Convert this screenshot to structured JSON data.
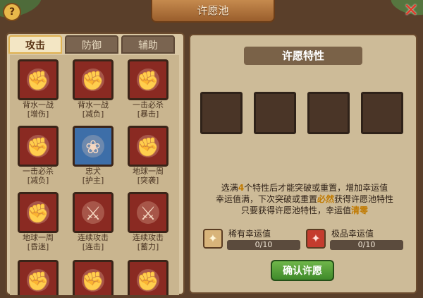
{
  "header": {
    "title": "许愿池"
  },
  "tabs": [
    {
      "label": "攻击",
      "active": true
    },
    {
      "label": "防御",
      "active": false
    },
    {
      "label": "辅助",
      "active": false
    }
  ],
  "skills": [
    {
      "name": "背水一战",
      "tag": "[增伤]",
      "icon": "berserker-portrait-icon",
      "color": "#8a2a22"
    },
    {
      "name": "背水一战",
      "tag": "[减负]",
      "icon": "berserker-portrait-icon",
      "color": "#8a2a22"
    },
    {
      "name": "一击必杀",
      "tag": "[暴击]",
      "icon": "punch-strike-icon",
      "color": "#8a2a22"
    },
    {
      "name": "一击必杀",
      "tag": "[减负]",
      "icon": "punch-strike-icon",
      "color": "#8a2a22"
    },
    {
      "name": "忠犬",
      "tag": "[护主]",
      "icon": "paw-print-icon",
      "color": "#3d6ea8"
    },
    {
      "name": "地球一周",
      "tag": "[突袭]",
      "icon": "globe-fist-icon",
      "color": "#8a2a22"
    },
    {
      "name": "地球一周",
      "tag": "[昏迷]",
      "icon": "globe-fist-icon",
      "color": "#8a2a22"
    },
    {
      "name": "连续攻击",
      "tag": "[连击]",
      "icon": "slash-combo-icon",
      "color": "#8a2a22"
    },
    {
      "name": "连续攻击",
      "tag": "[蓄力]",
      "icon": "slash-combo-icon",
      "color": "#8a2a22"
    },
    {
      "name": "",
      "tag": "",
      "icon": "berserker-portrait-icon",
      "color": "#8a2a22"
    },
    {
      "name": "",
      "tag": "",
      "icon": "berserker-portrait-icon",
      "color": "#8a2a22"
    },
    {
      "name": "",
      "tag": "",
      "icon": "paw-strike-icon",
      "color": "#8a2a22"
    }
  ],
  "wish": {
    "title": "许愿特性",
    "line1_pre": "选满",
    "line1_num": "4",
    "line1_post": "个特性后才能突破或重置，增加幸运值",
    "line2_pre": "幸运值满，下次突破或重置",
    "line2_hl": "必然",
    "line2_post": "获得许愿池特性",
    "line3_pre": "只要获得许愿池特性，幸运值",
    "line3_hl": "清零",
    "rare_label": "稀有幸运值",
    "rare_value": "0/10",
    "rare_progress": 0,
    "epic_label": "极品幸运值",
    "epic_value": "0/10",
    "epic_progress": 0,
    "confirm_label": "确认许愿"
  },
  "colors": {
    "accent": "#e0b252",
    "confirm": "#4f9e34",
    "highlight": "#c07a00",
    "close": "#e23a2a"
  }
}
